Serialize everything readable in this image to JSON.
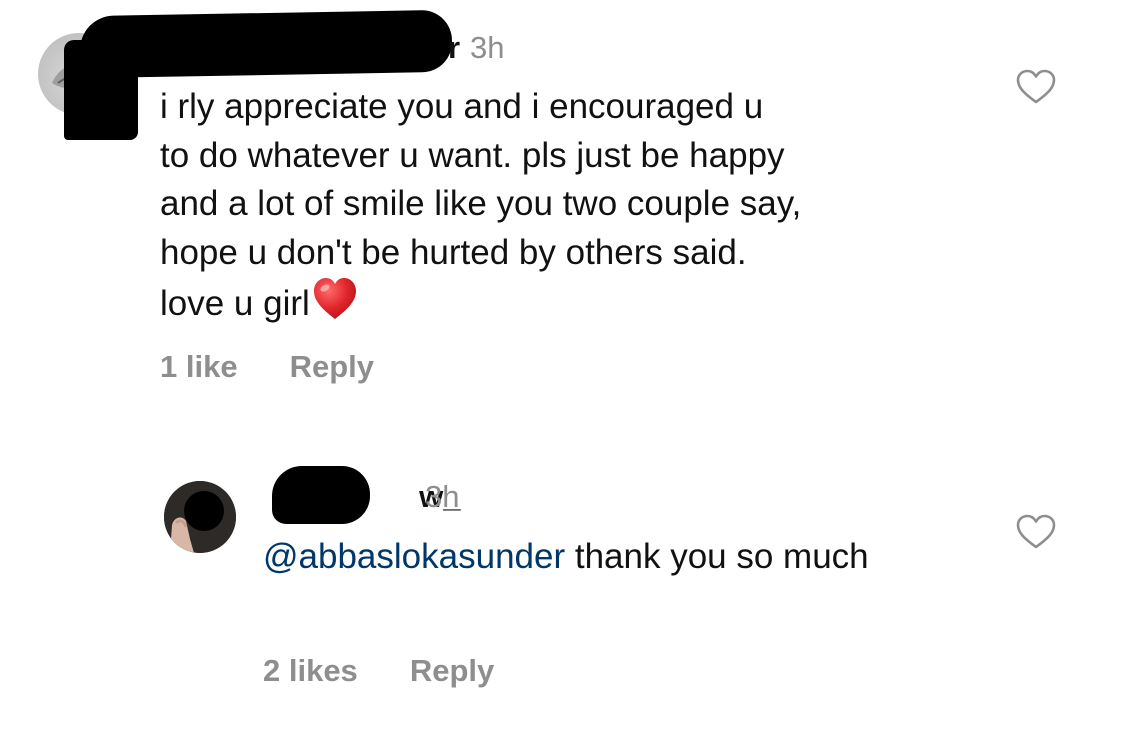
{
  "comments": [
    {
      "username_visible": "r",
      "time": "3h",
      "text": "i rly appreciate you and i encouraged u\nto do whatever u want. pls just be happy\nand a lot of smile like you two couple say,\nhope u don't be hurted by others said.\nlove u girl",
      "emoji": "heart",
      "likes": "1 like",
      "reply_label": "Reply",
      "like_icon": "heart-outline-icon"
    },
    {
      "username_visible": "w_",
      "time": "3h",
      "mention": "@abbaslokasunder",
      "text": " thank you so much",
      "likes": "2 likes",
      "reply_label": "Reply",
      "like_icon": "heart-outline-icon"
    }
  ],
  "colors": {
    "text": "#111111",
    "muted": "#8e8e8e",
    "mention": "#00376b",
    "emoji_heart": "#e0242b"
  }
}
